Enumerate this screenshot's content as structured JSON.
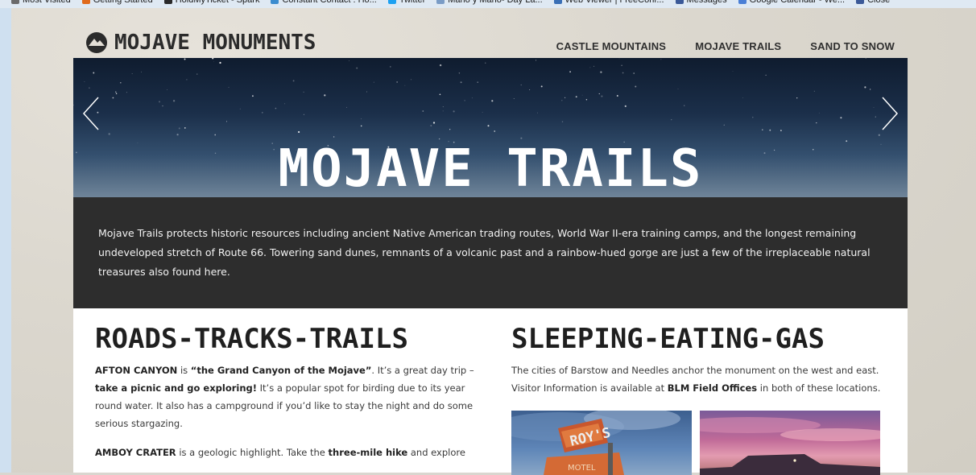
{
  "bookmarks": [
    {
      "label": "Most Visited",
      "icon": "star-icon",
      "color": "#6a6a6a"
    },
    {
      "label": "Getting Started",
      "icon": "firefox-icon",
      "color": "#e06a1b"
    },
    {
      "label": "HoldMyTicket - Spark",
      "icon": "ticket-icon",
      "color": "#2a2a2a"
    },
    {
      "label": "Constant Contact : Ho...",
      "icon": "mail-icon",
      "color": "#3b8ccf"
    },
    {
      "label": "Twitter",
      "icon": "twitter-icon",
      "color": "#1da1f2"
    },
    {
      "label": "Mano y Mano- Day La...",
      "icon": "globe-icon",
      "color": "#7a9cc6"
    },
    {
      "label": "Web Viewer | FreeConf...",
      "icon": "web-icon",
      "color": "#3a6fb5"
    },
    {
      "label": "Messages",
      "icon": "facebook-icon",
      "color": "#3b5998"
    },
    {
      "label": "Google Calendar - We...",
      "icon": "calendar-icon",
      "color": "#4a7fd6"
    },
    {
      "label": "Close",
      "icon": "facebook-icon",
      "color": "#3b5998"
    }
  ],
  "site": {
    "logo_text": "MOJAVE MONUMENTS",
    "nav": [
      "CASTLE MOUNTAINS",
      "MOJAVE TRAILS",
      "SAND TO SNOW"
    ]
  },
  "hero": {
    "title": "MOJAVE TRAILS",
    "description": "Mojave Trails protects historic resources including ancient Native American trading routes, World War II-era training camps, and the longest remaining undeveloped stretch of Route 66. Towering sand dunes, remnants of a volcanic past and a rainbow-hued gorge are just a few of the irreplaceable natural treasures also found here."
  },
  "left": {
    "title": "ROADS-TRACKS-TRAILS",
    "p1": [
      {
        "t": "AFTON CANYON",
        "b": true
      },
      {
        "t": " is ",
        "b": false
      },
      {
        "t": "“the Grand Canyon of the Mojave”",
        "b": true
      },
      {
        "t": ". It’s a great day trip – ",
        "b": false
      },
      {
        "t": "take a picnic and go exploring!",
        "b": true
      },
      {
        "t": " It’s a popular spot for birding due to its year round water. It also has a campground if you’d like to stay the night and do some serious stargazing.",
        "b": false
      }
    ],
    "p2": [
      {
        "t": "AMBOY CRATER",
        "b": true
      },
      {
        "t": " is a geologic highlight. Take the ",
        "b": false
      },
      {
        "t": "three-mile hike",
        "b": true
      },
      {
        "t": " and explore",
        "b": false
      }
    ]
  },
  "right": {
    "title": "SLEEPING-EATING-GAS",
    "p1": [
      {
        "t": "The cities of Barstow and Needles anchor the monument on the west and east. Visitor Information is available at ",
        "b": false
      },
      {
        "t": "BLM Field Offices",
        "b": true
      },
      {
        "t": " in both of these locations.",
        "b": false
      }
    ],
    "photo1_sign": "ROY'S",
    "photo1_sign2": "MOTEL"
  }
}
